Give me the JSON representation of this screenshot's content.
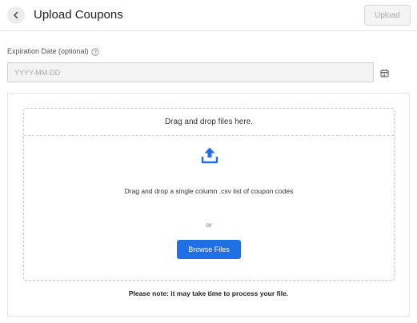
{
  "header": {
    "title": "Upload Coupons",
    "back_icon": "chevron-left-icon",
    "upload_label": "Upload"
  },
  "expiration": {
    "label": "Expiration Date (optional)",
    "help_icon": "question-circle-icon",
    "placeholder": "YYYY-MM-DD",
    "value": "",
    "calendar_icon": "calendar-icon"
  },
  "dropzone": {
    "header": "Drag and drop files here.",
    "upload_icon": "upload-icon",
    "description": "Drag and drop a single column .csv list of coupon codes",
    "or_text": "or",
    "browse_label": "Browse Files"
  },
  "note": "Please note: it may take time to process your file.",
  "colors": {
    "primary": "#1f6fe5",
    "disabled_button_bg": "#f4f4f4",
    "disabled_button_text": "#a8a8a8",
    "input_bg": "#f3f3f3"
  }
}
